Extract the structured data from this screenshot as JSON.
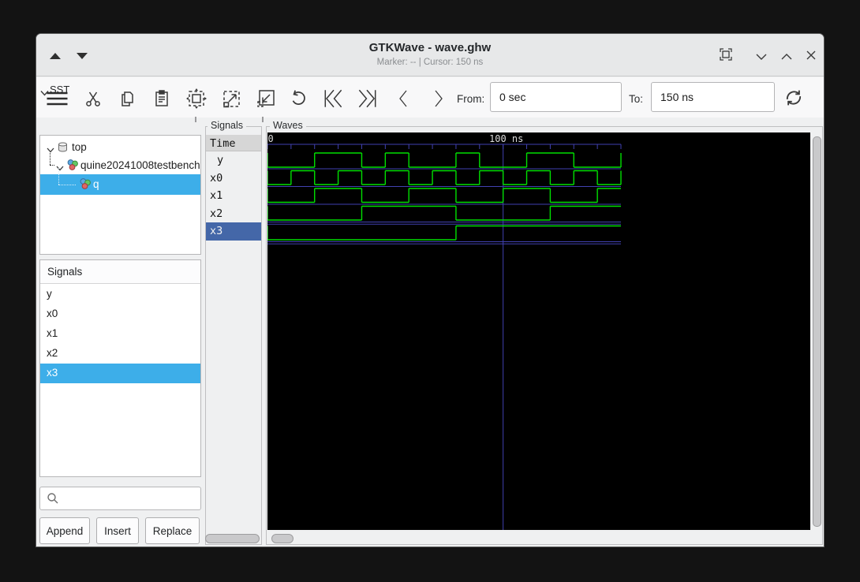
{
  "window": {
    "title": "GTKWave - wave.ghw",
    "status": "Marker: -- | Cursor: 150 ns",
    "controls": [
      "pan-up",
      "pan-down",
      "fullscreen",
      "minimize",
      "maximize",
      "close"
    ]
  },
  "toolbar": {
    "icons": [
      "menu",
      "cut",
      "copy",
      "paste",
      "zoom-fit",
      "zoom-in",
      "zoom-out",
      "undo",
      "skip-to-start",
      "skip-to-end",
      "step-left",
      "step-right",
      "reload"
    ],
    "from_label": "From:",
    "from_value": "0 sec",
    "to_label": "To:",
    "to_value": "150 ns"
  },
  "sst": {
    "label": "SST",
    "tree": [
      {
        "label": "top",
        "selected": false
      },
      {
        "label": "quine20241008testbench",
        "selected": false
      },
      {
        "label": "q",
        "selected": true
      }
    ]
  },
  "signals_list": {
    "header": "Signals",
    "items": [
      "y",
      "x0",
      "x1",
      "x2",
      "x3"
    ],
    "selected": "x3",
    "search_placeholder": "",
    "buttons": [
      "Append",
      "Insert",
      "Replace"
    ]
  },
  "signals_panel": {
    "frame_label": "Signals",
    "time_header": "Time",
    "items": [
      "y",
      "x0",
      "x1",
      "x2",
      "x3"
    ],
    "selected": "x3"
  },
  "waves_panel": {
    "frame_label": "Waves"
  },
  "chart_data": {
    "type": "line",
    "subtype": "digital-timing",
    "title": "Waves",
    "time_unit": "ns",
    "t_start": 0,
    "t_end": 150,
    "tick_interval": 10,
    "axis_labels": {
      "start": "0",
      "major": "100 ns"
    },
    "major_gridline_time": 100,
    "colors": {
      "trace": "#00df00",
      "grid": "#4141b0",
      "background": "#000000",
      "text": "#dcdcdc"
    },
    "series": [
      {
        "name": "y",
        "transitions": [
          [
            0,
            0
          ],
          [
            20,
            1
          ],
          [
            40,
            0
          ],
          [
            50,
            1
          ],
          [
            60,
            0
          ],
          [
            80,
            1
          ],
          [
            90,
            0
          ],
          [
            110,
            1
          ],
          [
            130,
            0
          ],
          [
            150,
            1
          ]
        ]
      },
      {
        "name": "x0",
        "transitions": [
          [
            0,
            0
          ],
          [
            10,
            1
          ],
          [
            20,
            0
          ],
          [
            30,
            1
          ],
          [
            40,
            0
          ],
          [
            50,
            1
          ],
          [
            60,
            0
          ],
          [
            70,
            1
          ],
          [
            80,
            0
          ],
          [
            90,
            1
          ],
          [
            100,
            0
          ],
          [
            110,
            1
          ],
          [
            120,
            0
          ],
          [
            130,
            1
          ],
          [
            140,
            0
          ],
          [
            150,
            1
          ]
        ]
      },
      {
        "name": "x1",
        "transitions": [
          [
            0,
            0
          ],
          [
            20,
            1
          ],
          [
            40,
            0
          ],
          [
            60,
            1
          ],
          [
            80,
            0
          ],
          [
            100,
            1
          ],
          [
            120,
            0
          ],
          [
            140,
            1
          ]
        ]
      },
      {
        "name": "x2",
        "transitions": [
          [
            0,
            0
          ],
          [
            40,
            1
          ],
          [
            80,
            0
          ],
          [
            120,
            1
          ]
        ]
      },
      {
        "name": "x3",
        "transitions": [
          [
            0,
            0
          ],
          [
            80,
            1
          ]
        ]
      }
    ]
  }
}
